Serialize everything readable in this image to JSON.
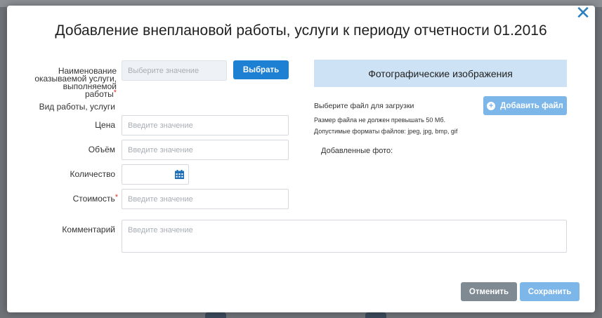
{
  "dialog": {
    "title": "Добавление внеплановой работы, услуги к периоду отчетности 01.2016",
    "close_glyph": "✕"
  },
  "form": {
    "name_label": "Наименование оказываемой услуги, выполняемой работы",
    "name_placeholder": "Выберите значение",
    "select_button": "Выбрать",
    "work_type_label": "Вид работы, услуги",
    "price_label": "Цена",
    "price_placeholder": "Введите значение",
    "volume_label": "Объём",
    "volume_placeholder": "Введите значение",
    "quantity_label": "Количество",
    "cost_label": "Стоимость",
    "cost_placeholder": "Введите значение",
    "comment_label": "Комментарий",
    "comment_placeholder": "Введите значение",
    "required_mark": "*"
  },
  "photos": {
    "header": "Фотографические изображения",
    "choose_file_text": "Выберите файл для загрузки",
    "add_file_button": "Добавить файл",
    "size_limit_text": "Размер файла не должен превышать 50 Мб.",
    "formats_text": "Допустимые форматы файлов: jpeg, jpg, bmp, gif",
    "added_label": "Добавленные фото:"
  },
  "footer": {
    "cancel_button": "Отменить",
    "save_button": "Сохранить"
  },
  "icons": {
    "close": "close-icon",
    "calendar": "calendar-icon",
    "plus": "plus-circle-icon"
  },
  "colors": {
    "primary": "#1e80d2",
    "primary_light": "#7db6e8",
    "grey_button": "#7f8a92",
    "photo_header_bg": "#cde3f5",
    "required": "#d9342b"
  }
}
